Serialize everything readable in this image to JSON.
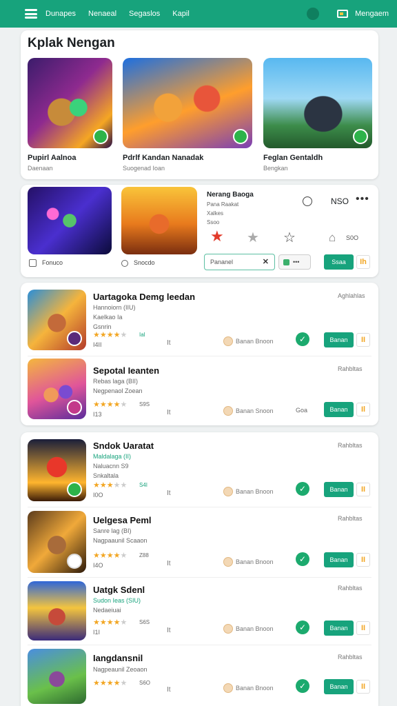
{
  "topbar": {
    "nav": [
      "Dunapes",
      "Nenaeal",
      "Segaslos",
      "Kapil"
    ],
    "user_label": "Mengaem"
  },
  "featured": {
    "title": "Kplak Nengan",
    "items": [
      {
        "name": "Pupirl Aalnoa",
        "sub": "Daenaan"
      },
      {
        "name": "Pdrlf Kandan Nanadak",
        "sub": "Suogenad Ioan"
      },
      {
        "name": "Feglan Gentaldh",
        "sub": "Bengkan"
      }
    ]
  },
  "panel": {
    "left_labels": [
      "Fonuco",
      "Snocdo"
    ],
    "info_title": "Nerang Baoga",
    "info_lines": [
      "Pana Raakat",
      "Xalkes",
      "Ssoo"
    ],
    "price": "NSO",
    "house_value": "S0O",
    "field_value": "Pananel",
    "chip_label": "",
    "btn_primary": "Ssaa",
    "btn_secondary": "Ih"
  },
  "list1": [
    {
      "name": "Uartagoka Demg leedan",
      "meta1": "Hannoiorn (IIU)",
      "meta2": "Kaelkao  Ia",
      "meta3": "Gsnrin",
      "rating": 4,
      "count": "Ial",
      "left_num": "I4II",
      "pin": "It",
      "coin_text": "Banan Bnoon",
      "status": "check",
      "right_label": "Aghlahlas",
      "btn": "Banan",
      "btn2": "II"
    },
    {
      "name": "Sepotal Ieanten",
      "meta1": "Rebas laga (BII)",
      "meta2": "Negpenaol  Zoean",
      "meta3": "",
      "rating": 4,
      "count": "S9S",
      "left_num": "I13",
      "pin": "It",
      "coin_text": "Banan Snoon",
      "status": "Goa",
      "right_label": "Rahbltas",
      "btn": "Banan",
      "btn2": "Il"
    }
  ],
  "list2": [
    {
      "name": "Sndok Uaratat",
      "meta1": "Maldalaga (II)",
      "meta2": "Naluacnn  S9",
      "meta3": "Snkaltala",
      "rating": 3,
      "count": "S4I",
      "left_num": "I0O",
      "pin": "It",
      "coin_text": "Banan Bnoon",
      "status": "check",
      "right_label": "Rahbltas",
      "btn": "Banan",
      "btn2": "II"
    },
    {
      "name": "Uelgesa Peml",
      "meta1": "Sanre lag (BI)",
      "meta2": "Nagpaaunil  Scaaon",
      "meta3": "",
      "rating": 4,
      "count": "Z88",
      "left_num": "I4O",
      "pin": "It",
      "coin_text": "Banan Bnoon",
      "status": "check",
      "right_label": "Rahbltas",
      "btn": "Banan",
      "btn2": "II"
    },
    {
      "name": "Uatgk Sdenl",
      "meta1": "Sudon Ieas (SIU)",
      "meta2": "Nedaeiuai",
      "meta3": "",
      "rating": 4,
      "count": "S6S",
      "left_num": "I1I",
      "pin": "It",
      "coin_text": "Banan Bnoon",
      "status": "check",
      "right_label": "Rahbltas",
      "btn": "Banan",
      "btn2": "II"
    },
    {
      "name": "Iangdansnil",
      "meta1": "Nagpeaunil  Zeoaon",
      "meta2": "",
      "meta3": "",
      "rating": 4,
      "count": "S6O",
      "left_num": "",
      "pin": "It",
      "coin_text": "Banan Bnoon",
      "status": "check",
      "right_label": "Rahbltas",
      "btn": "Banan",
      "btn2": "II"
    }
  ]
}
